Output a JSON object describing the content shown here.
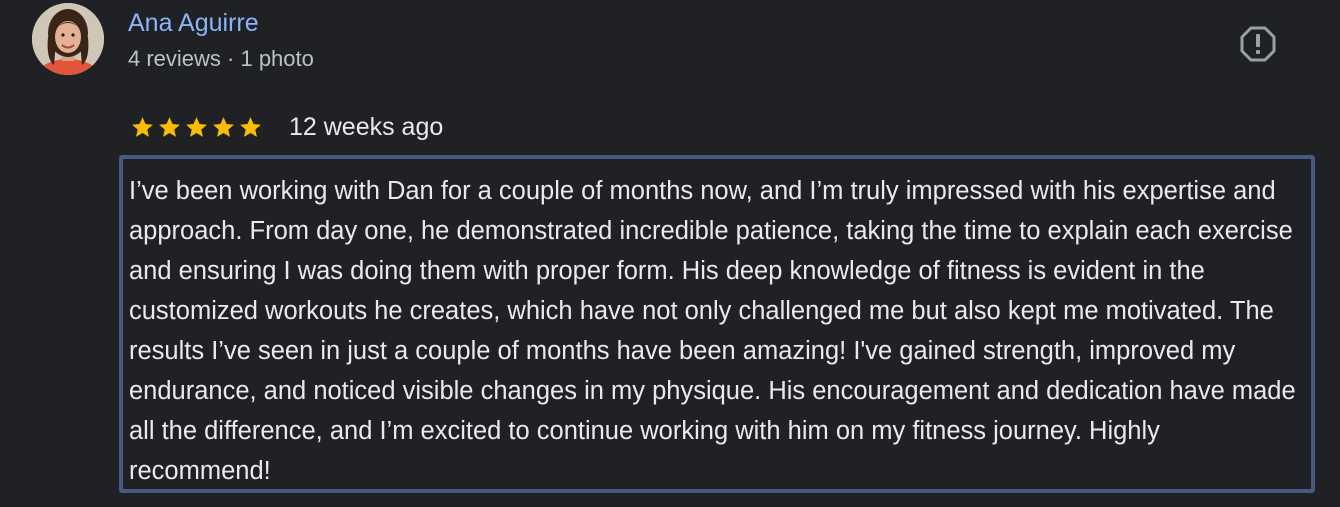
{
  "author": {
    "name": "Ana Aguirre",
    "meta": "4 reviews · 1 photo"
  },
  "icons": {
    "avatar": "profile-photo",
    "report": "report-flag-icon",
    "star": "star-icon"
  },
  "rating": {
    "stars": 5,
    "max": 5,
    "color": "#fbbc04"
  },
  "review": {
    "date": "12 weeks ago",
    "text": "I’ve been working with Dan for a couple of months now, and I’m truly impressed with his expertise and approach. From day one, he demonstrated incredible patience, taking the time to explain each exercise and ensuring I was doing them with proper form. His deep knowledge of fitness is evident in the customized workouts he creates, which have not only challenged me but also kept me motivated. The results I’ve seen in just a couple of months have been amazing! I've gained strength, improved my endurance, and noticed visible changes in my physique. His encouragement and dedication have made all the difference, and I’m excited to continue working with him on my fitness journey. Highly recommend!"
  },
  "colors": {
    "background": "#202124",
    "name": "#8ab4f8",
    "text": "#e8eaed",
    "highlight_border": "#475a80"
  }
}
